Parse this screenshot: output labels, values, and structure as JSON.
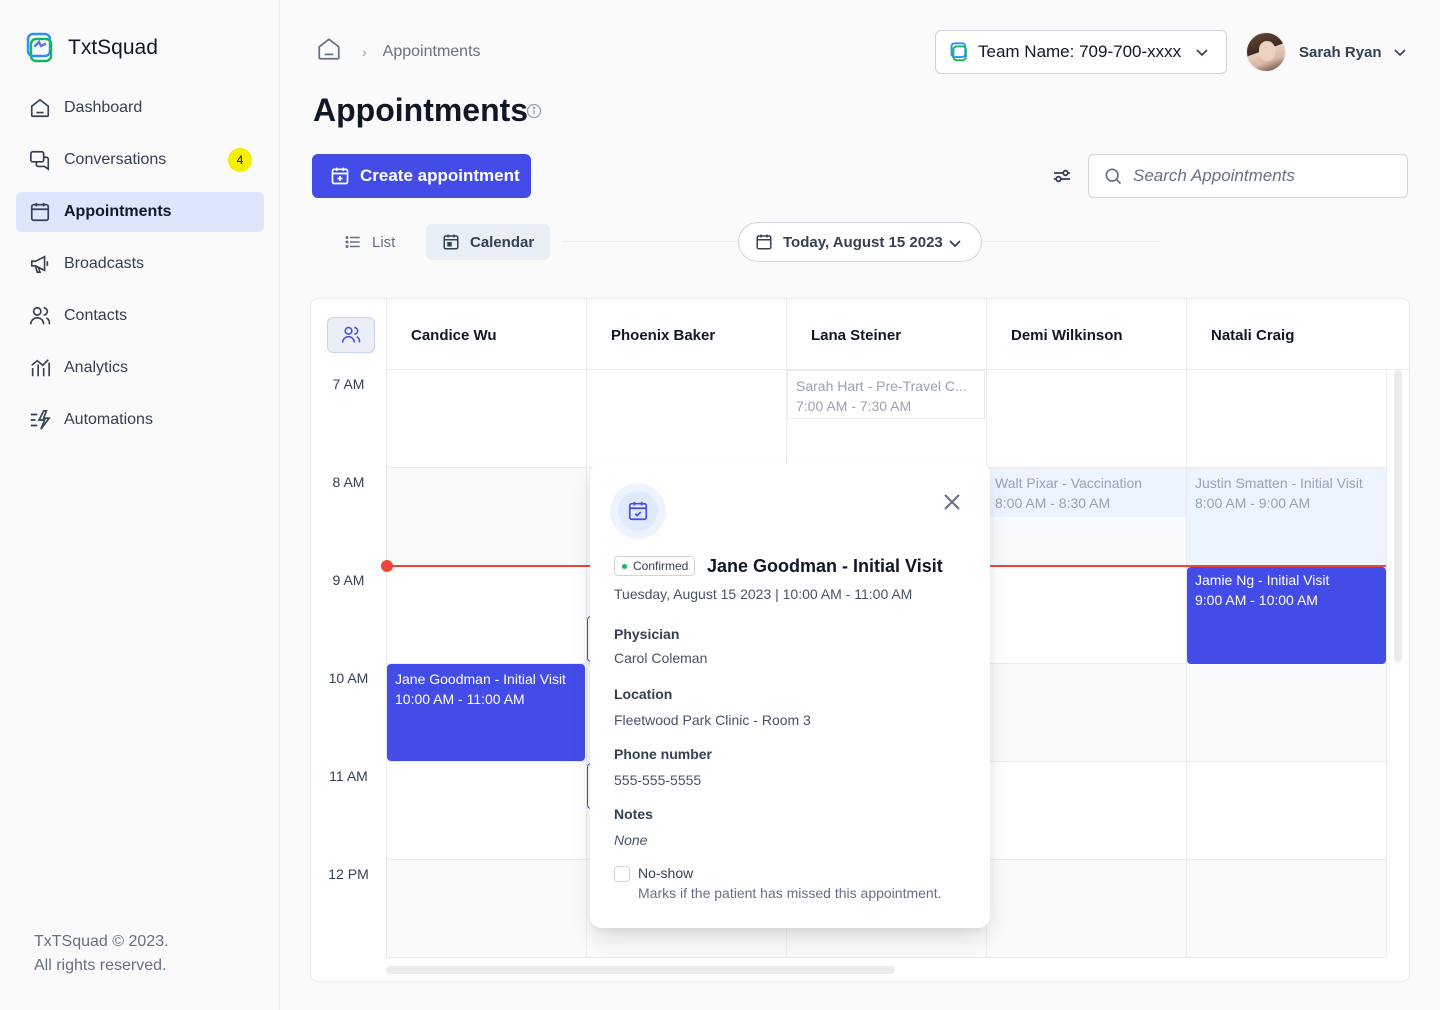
{
  "app": {
    "name": "TxtSquad"
  },
  "sidebar": {
    "items": [
      {
        "label": "Dashboard",
        "icon": "home-icon"
      },
      {
        "label": "Conversations",
        "icon": "chat-icon",
        "badge": "4"
      },
      {
        "label": "Appointments",
        "icon": "calendar-icon",
        "active": true
      },
      {
        "label": "Broadcasts",
        "icon": "megaphone-icon"
      },
      {
        "label": "Contacts",
        "icon": "users-icon"
      },
      {
        "label": "Analytics",
        "icon": "chart-icon"
      },
      {
        "label": "Automations",
        "icon": "automation-icon"
      }
    ],
    "footer_line1": "TxTSquad © 2023.",
    "footer_line2": "All rights reserved."
  },
  "header": {
    "breadcrumb_current": "Appointments",
    "team_select": "Team Name: 709-700-xxxx",
    "user_name": "Sarah Ryan"
  },
  "page": {
    "title": "Appointments",
    "create_button": "Create appointment",
    "search_placeholder": "Search Appointments",
    "view_list": "List",
    "view_calendar": "Calendar",
    "date": "Today, August 15 2023"
  },
  "calendar": {
    "columns": [
      "Candice Wu",
      "Phoenix Baker",
      "Lana Steiner",
      "Demi Wilkinson",
      "Natali Craig"
    ],
    "times": [
      "7 AM",
      "8 AM",
      "9 AM",
      "10 AM",
      "11 AM",
      "12 PM"
    ],
    "events": [
      {
        "title": "Sarah Hart - Pre-Travel C...",
        "time": "7:00 AM - 7:30 AM"
      },
      {
        "title": "Walt Pixar - Vaccination",
        "time": "8:00 AM - 8:30 AM"
      },
      {
        "title": "Justin Smatten - Initial Visit",
        "time": "8:00 AM - 9:00 AM"
      },
      {
        "title": "Jamie Ng - Initial Visit",
        "time": "9:00 AM - 10:00 AM"
      },
      {
        "title": "Jane Goodman - Initial Visit",
        "time": "10:00 AM - 11:00 AM"
      }
    ]
  },
  "popover": {
    "status": "Confirmed",
    "title": "Jane Goodman - Initial Visit",
    "datetime": "Tuesday, August 15 2023 | 10:00 AM - 11:00 AM",
    "physician_label": "Physician",
    "physician": "Carol Coleman",
    "location_label": "Location",
    "location": "Fleetwood Park Clinic - Room 3",
    "phone_label": "Phone number",
    "phone": "555-555-5555",
    "notes_label": "Notes",
    "notes": "None",
    "noshow_label": "No-show",
    "noshow_hint": "Marks if the patient has missed this appointment."
  },
  "colors": {
    "accent": "#444ce7",
    "active_nav": "#dde6fb",
    "now_line": "#f04438",
    "badge": "#f5f000"
  }
}
